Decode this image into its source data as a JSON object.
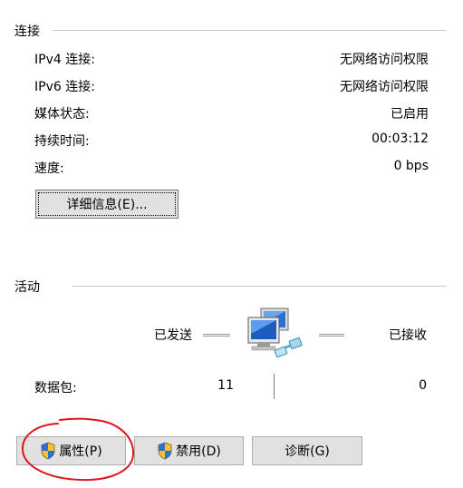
{
  "connection": {
    "title": "连接",
    "rows": [
      {
        "label": "IPv4 连接:",
        "value": "无网络访问权限"
      },
      {
        "label": "IPv6 连接:",
        "value": "无网络访问权限"
      },
      {
        "label": "媒体状态:",
        "value": "已启用"
      },
      {
        "label": "持续时间:",
        "value": "00:03:12"
      },
      {
        "label": "速度:",
        "value": "0 bps"
      }
    ],
    "details_button": "详细信息(E)..."
  },
  "activity": {
    "title": "活动",
    "sent_label": "已发送",
    "received_label": "已接收",
    "packets_label": "数据包:",
    "packets_sent": "11",
    "packets_received": "0"
  },
  "buttons": {
    "properties": "属性(P)",
    "disable": "禁用(D)",
    "diagnose": "诊断(G)"
  },
  "icons": {
    "network": "network-computers-icon",
    "shield": "uac-shield-icon"
  },
  "colors": {
    "annotation": "#e0141e",
    "button_bg": "#e1e1e1",
    "button_border": "#adadad",
    "monitor_blue": "#1e5bbf"
  }
}
